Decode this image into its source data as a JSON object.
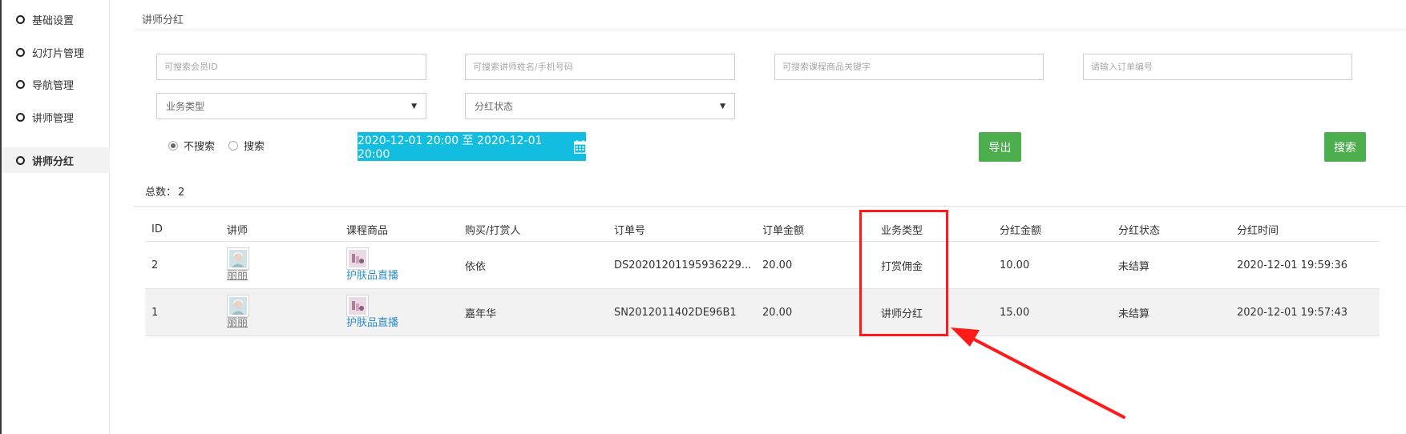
{
  "sidebar": {
    "items": [
      {
        "label": "基础设置",
        "active": false
      },
      {
        "label": "幻灯片管理",
        "active": false
      },
      {
        "label": "导航管理",
        "active": false
      },
      {
        "label": "讲师管理",
        "active": false
      },
      {
        "label": "讲师分红",
        "active": true
      }
    ]
  },
  "header": {
    "title": "讲师分红"
  },
  "filters": {
    "member_placeholder": "可搜索会员ID",
    "teacher_placeholder": "可搜索讲师姓名/手机号码",
    "course_placeholder": "可搜索课程商品关键字",
    "order_placeholder": "请输入订单编号",
    "business_type": "业务类型",
    "dividend_status": "分红状态",
    "radio_no_search": "不搜索",
    "radio_search": "搜索",
    "date_range": "2020-12-01 20:00 至 2020-12-01 20:00",
    "export_label": "导出",
    "search_label": "搜索"
  },
  "summary": {
    "total_label": "总数：",
    "total_value": "2"
  },
  "table": {
    "columns": [
      "ID",
      "讲师",
      "课程商品",
      "购买/打赏人",
      "订单号",
      "订单金额",
      "业务类型",
      "分红金额",
      "分红状态",
      "分红时间"
    ],
    "rows": [
      {
        "id": "2",
        "teacher": "丽丽",
        "course": "护肤品直播",
        "buyer": "依依",
        "order_no": "DS20201201195936229...",
        "amount": "20.00",
        "business_type": "打赏佣金",
        "dividend": "10.00",
        "status": "未结算",
        "time": "2020-12-01 19:59:36"
      },
      {
        "id": "1",
        "teacher": "丽丽",
        "course": "护肤品直播",
        "buyer": "嘉年华",
        "order_no": "SN2012011402DE96B1",
        "amount": "20.00",
        "business_type": "讲师分红",
        "dividend": "15.00",
        "status": "未结算",
        "time": "2020-12-01 19:57:43"
      }
    ]
  },
  "colors": {
    "date_button": "#13bde0",
    "green_button": "#4cae4c",
    "annotation": "#ff1a1a"
  }
}
